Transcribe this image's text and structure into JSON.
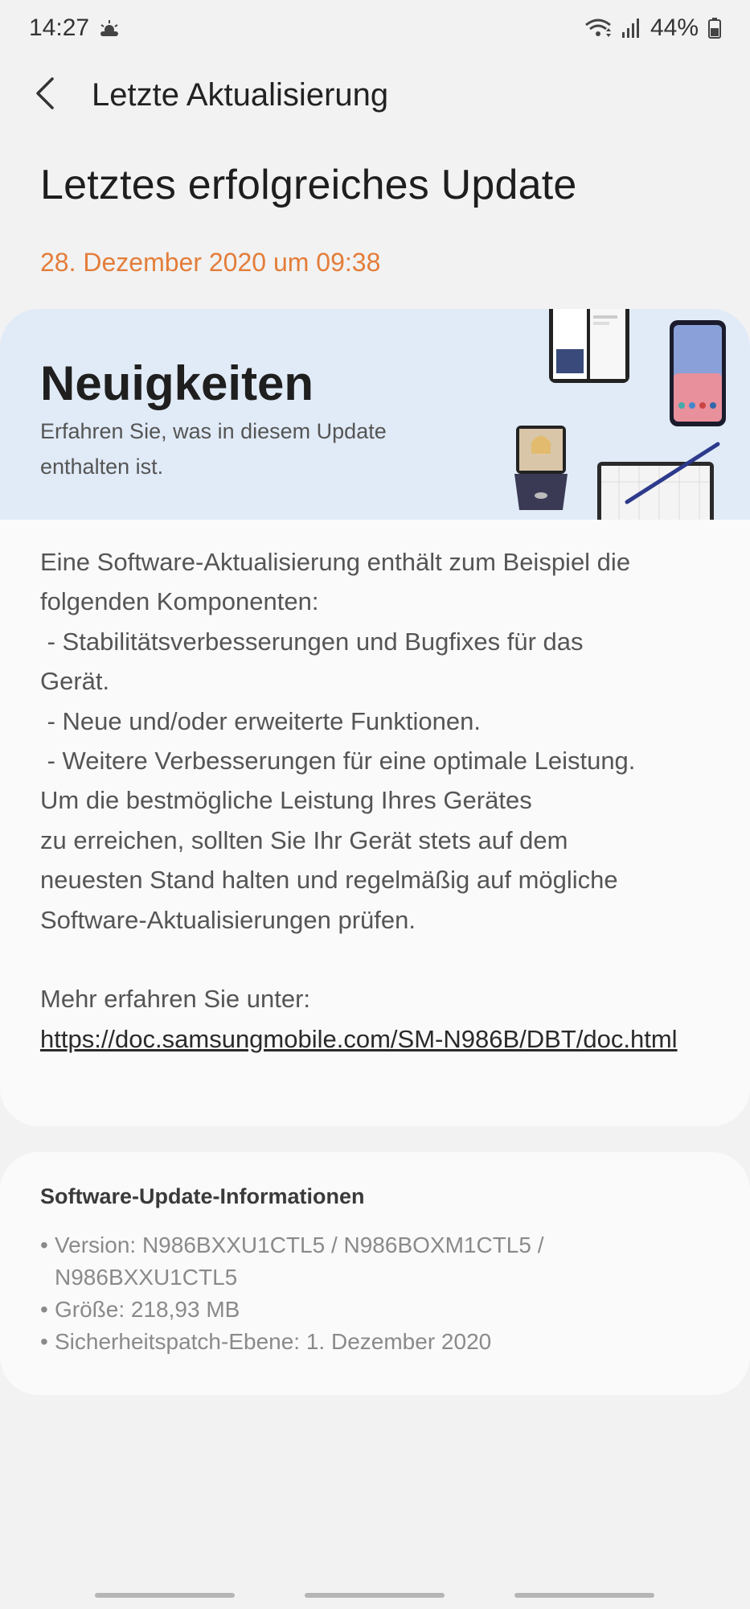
{
  "status_bar": {
    "time": "14:27",
    "weather_icon": "sun-cloud-icon",
    "battery": "44%",
    "icons": [
      "wifi-icon",
      "signal-icon",
      "battery-icon"
    ]
  },
  "app_bar": {
    "title": "Letzte Aktualisierung",
    "back_icon": "chevron-left-icon"
  },
  "headline": "Letztes erfolgreiches Update",
  "update_date": "28. Dezember 2020 um 09:38",
  "news": {
    "title": "Neuigkeiten",
    "subtitle": "Erfahren Sie, was in diesem Update enthalten ist.",
    "lines": [
      "Eine Software-Aktualisierung enthält zum Beispiel die",
      "folgenden Komponenten:",
      " - Stabilitätsverbesserungen und Bugfixes für das",
      "Gerät.",
      " - Neue und/oder erweiterte Funktionen.",
      " - Weitere Verbesserungen für eine optimale Leistung.",
      "Um die bestmögliche Leistung Ihres Gerätes",
      "zu erreichen, sollten Sie Ihr Gerät stets auf dem",
      "neuesten Stand halten und regelmäßig auf mögliche",
      "Software-Aktualisierungen prüfen."
    ],
    "more_label": "Mehr erfahren Sie unter:",
    "more_link": "https://doc.samsungmobile.com/SM-N986B/DBT/doc.html"
  },
  "info": {
    "title": "Software-Update-Informationen",
    "version": "Version: N986BXXU1CTL5 / N986BOXM1CTL5 / N986BXXU1CTL5",
    "size": "Größe: 218,93 MB",
    "patch": "Sicherheitspatch-Ebene: 1. Dezember 2020"
  },
  "colors": {
    "accent_orange": "#e47d3a",
    "banner_blue": "#e1ebf7",
    "background": "#f2f2f2",
    "card": "#fafafa"
  }
}
